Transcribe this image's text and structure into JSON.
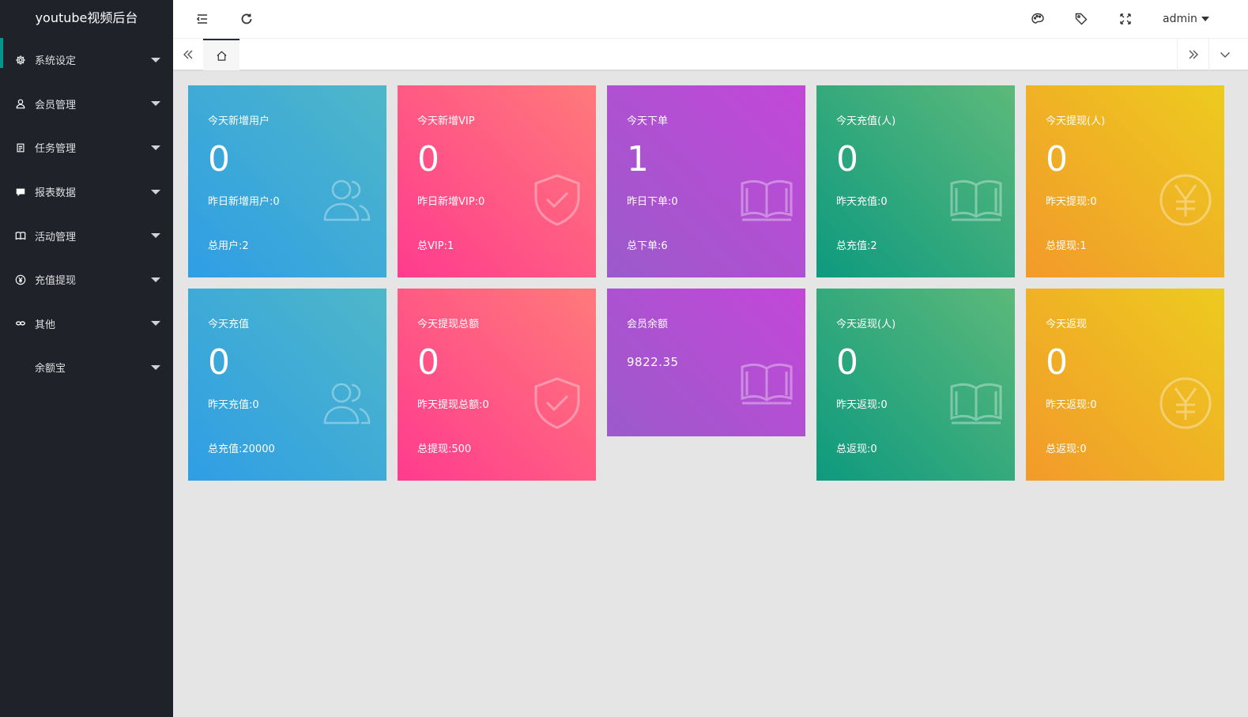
{
  "app": {
    "title": "youtube视频后台"
  },
  "sidebar": {
    "items": [
      {
        "label": "系统设定",
        "icon": "gear-icon"
      },
      {
        "label": "会员管理",
        "icon": "user-icon"
      },
      {
        "label": "任务管理",
        "icon": "document-icon"
      },
      {
        "label": "报表数据",
        "icon": "chat-icon"
      },
      {
        "label": "活动管理",
        "icon": "book-icon"
      },
      {
        "label": "充值提现",
        "icon": "yen-icon"
      },
      {
        "label": "其他",
        "icon": "link-icon"
      },
      {
        "label": "余额宝",
        "icon": ""
      }
    ]
  },
  "header": {
    "icons": [
      "menu-collapse-icon",
      "refresh-icon",
      "theme-icon",
      "tag-icon",
      "fullscreen-icon"
    ],
    "user": "admin"
  },
  "tabs": {
    "home_icon": "home-icon"
  },
  "colors": {
    "blue": "#2f9ee5",
    "pink": "#ff3b8e",
    "purple": "#9b5acb",
    "green": "#0e9a7f",
    "orange": "#f29a2a",
    "sidebar": "#20222a",
    "accent": "#009688"
  },
  "cards": [
    {
      "title": "今天新增用户",
      "value": "0",
      "sub1": "昨日新增用户:0",
      "sub2": "总用户:2",
      "icon": "users-icon"
    },
    {
      "title": "今天新增VIP",
      "value": "0",
      "sub1": "昨日新增VIP:0",
      "sub2": "总VIP:1",
      "icon": "shield-check-icon"
    },
    {
      "title": "今天下单",
      "value": "1",
      "sub1": "昨日下单:0",
      "sub2": "总下单:6",
      "icon": "book-open-icon"
    },
    {
      "title": "今天充值(人)",
      "value": "0",
      "sub1": "昨天充值:0",
      "sub2": "总充值:2",
      "icon": "book-open-icon"
    },
    {
      "title": "今天提现(人)",
      "value": "0",
      "sub1": "昨天提现:0",
      "sub2": "总提现:1",
      "icon": "yen-circle-icon"
    },
    {
      "title": "今天充值",
      "value": "0",
      "sub1": "昨天充值:0",
      "sub2": "总充值:20000",
      "icon": "users-icon"
    },
    {
      "title": "今天提现总额",
      "value": "0",
      "sub1": "昨天提现总额:0",
      "sub2": "总提现:500",
      "icon": "shield-check-icon"
    },
    {
      "title": "会员余额",
      "value": "9822.35",
      "icon": "book-open-icon"
    },
    {
      "title": "今天返现(人)",
      "value": "0",
      "sub1": "昨天返现:0",
      "sub2": "总返现:0",
      "icon": "book-open-icon"
    },
    {
      "title": "今天返现",
      "value": "0",
      "sub1": "昨天返现:0",
      "sub2": "总返现:0",
      "icon": "yen-circle-icon"
    }
  ]
}
